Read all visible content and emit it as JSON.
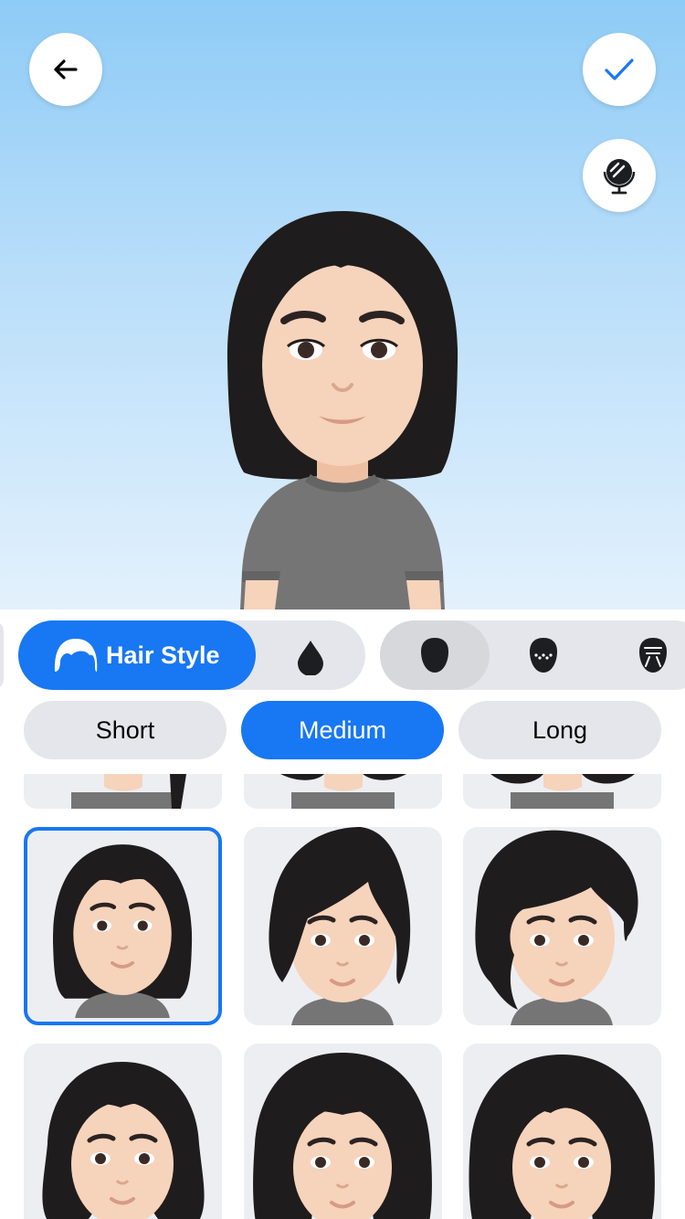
{
  "header": {
    "back_icon": "arrow-left-icon",
    "confirm_icon": "checkmark-icon",
    "mirror_icon": "mirror-icon"
  },
  "categories": {
    "active_label": "Hair Style",
    "items": [
      {
        "icon": "hair-icon",
        "label": "Hair Style",
        "active": true
      },
      {
        "icon": "hair-color-drop-icon"
      },
      {
        "icon": "face-shape-icon"
      },
      {
        "icon": "face-freckles-icon"
      },
      {
        "icon": "face-lines-icon"
      }
    ]
  },
  "subtabs": {
    "short": "Short",
    "medium": "Medium",
    "long": "Long",
    "active": "Medium"
  },
  "colors": {
    "accent": "#1877f2",
    "tile_bg": "#eceef2",
    "pill_bg": "#e4e6eb",
    "hair": "#1f1c1d",
    "skin": "#f6d3bb",
    "shirt": "#757575"
  },
  "grid": {
    "selected_index": 0
  }
}
